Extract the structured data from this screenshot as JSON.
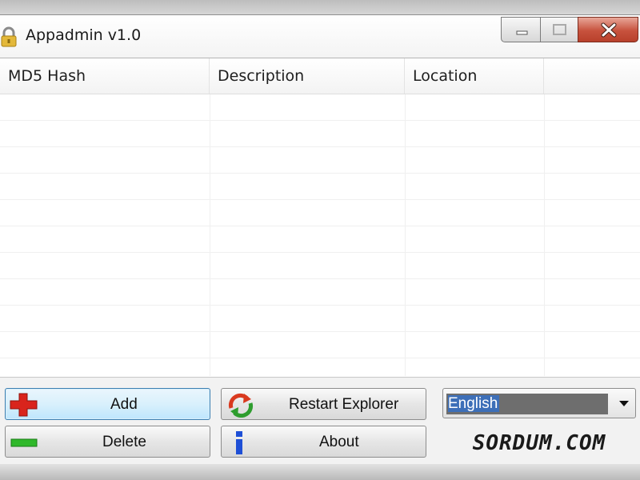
{
  "window": {
    "title": "Appadmin v1.0"
  },
  "list": {
    "columns": [
      "MD5 Hash",
      "Description",
      "Location",
      ""
    ]
  },
  "buttons": {
    "add": "Add",
    "delete": "Delete",
    "restart_explorer": "Restart Explorer",
    "about": "About"
  },
  "language": {
    "selected": "English"
  },
  "logo_text": "SORDUM.COM",
  "icons": {
    "title": "lock-icon",
    "add": "red-plus-icon",
    "delete": "green-minus-icon",
    "restart": "refresh-arrows-icon",
    "about": "blue-info-icon"
  },
  "colors": {
    "add_icon": "#d9241c",
    "delete_icon": "#2fb82a",
    "about_icon": "#1e4fd6"
  }
}
